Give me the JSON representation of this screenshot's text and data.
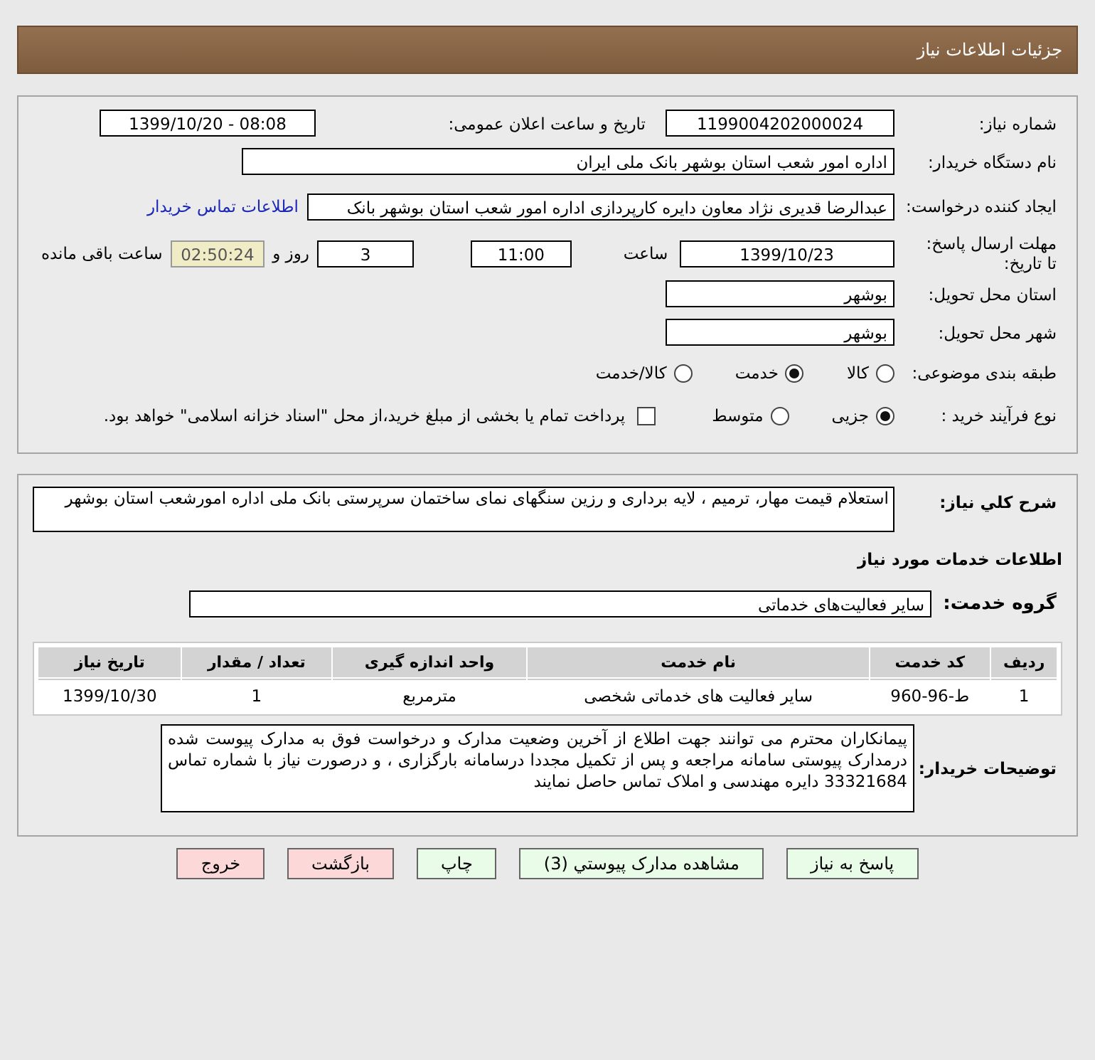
{
  "header": {
    "title": "جزئیات اطلاعات نیاز"
  },
  "need_number": {
    "label": "شماره نیاز:",
    "value": "1199004202000024"
  },
  "announce_date": {
    "label": "تاریخ و ساعت اعلان عمومی:",
    "value": "1399/10/20 - 08:08"
  },
  "buyer_org": {
    "label": "نام دستگاه خریدار:",
    "value": "اداره امور شعب استان بوشهر بانک ملی ایران"
  },
  "requester": {
    "label": "ایجاد کننده درخواست:",
    "value": "عبدالرضا  قدیری نژاد معاون دایره کارپردازی  اداره امور شعب استان بوشهر بانک",
    "link": "اطلاعات تماس خریدار"
  },
  "deadline": {
    "label_lines": [
      "مهلت ارسال پاسخ:",
      "تا تاریخ:"
    ],
    "date": "1399/10/23",
    "time_label": "ساعت",
    "time": "11:00",
    "days": "3",
    "days_label": "روز و",
    "remaining": "02:50:24",
    "remaining_label": "ساعت باقی مانده"
  },
  "province": {
    "label": "استان محل تحویل:",
    "value": "بوشهر"
  },
  "city": {
    "label": "شهر محل تحویل:",
    "value": "بوشهر"
  },
  "category": {
    "label": "طبقه بندی موضوعی:",
    "options": [
      {
        "label": "کالا",
        "selected": false
      },
      {
        "label": "خدمت",
        "selected": true
      },
      {
        "label": "کالا/خدمت",
        "selected": false
      }
    ]
  },
  "purchase_process": {
    "label": "نوع فرآیند خرید :",
    "options": [
      {
        "label": "جزیی",
        "selected": true
      },
      {
        "label": "متوسط",
        "selected": false
      }
    ],
    "payment": {
      "label": "پرداخت تمام یا بخشی از مبلغ خرید،از محل \"اسناد خزانه اسلامی\" خواهد بود.",
      "checked": false
    }
  },
  "description": {
    "label": "شرح کلي نياز:",
    "value": "استعلام قیمت مهار، ترمیم ، لایه برداری و رزین سنگهای نمای ساختمان سرپرستی بانک ملی اداره امورشعب استان بوشهر"
  },
  "services_heading": "اطلاعات خدمات مورد نیاز",
  "service_group": {
    "label": "گروه خدمت:",
    "value": "سایر فعالیت‌های خدماتی"
  },
  "table": {
    "columns": [
      "ردیف",
      "کد خدمت",
      "نام خدمت",
      "واحد اندازه گیری",
      "تعداد / مقدار",
      "تاریخ نیاز"
    ],
    "rows": [
      [
        "1",
        "ط-96-960",
        "سایر فعالیت های خدماتی شخصی",
        "مترمربع",
        "1",
        "1399/10/30"
      ]
    ]
  },
  "buyer_notes": {
    "label": "توضیحات خریدار:",
    "value": "پیمانکاران محترم می توانند جهت اطلاع از آخرین وضعیت مدارک و درخواست فوق به مدارک پیوست شده درمدارک پیوستی سامانه مراجعه و پس از تکمیل مجددا درسامانه بارگزاری ، و درصورت نیاز با شماره تماس 33321684 دایره مهندسی و املاک تماس حاصل نمایند"
  },
  "buttons": [
    {
      "label": "پاسخ به نیاز",
      "kind": "action"
    },
    {
      "label": "مشاهده مدارک پیوستي (3)",
      "kind": "action"
    },
    {
      "label": "چاپ",
      "kind": "action"
    },
    {
      "label": "بازگشت",
      "kind": "danger"
    },
    {
      "label": "خروج",
      "kind": "danger"
    }
  ]
}
